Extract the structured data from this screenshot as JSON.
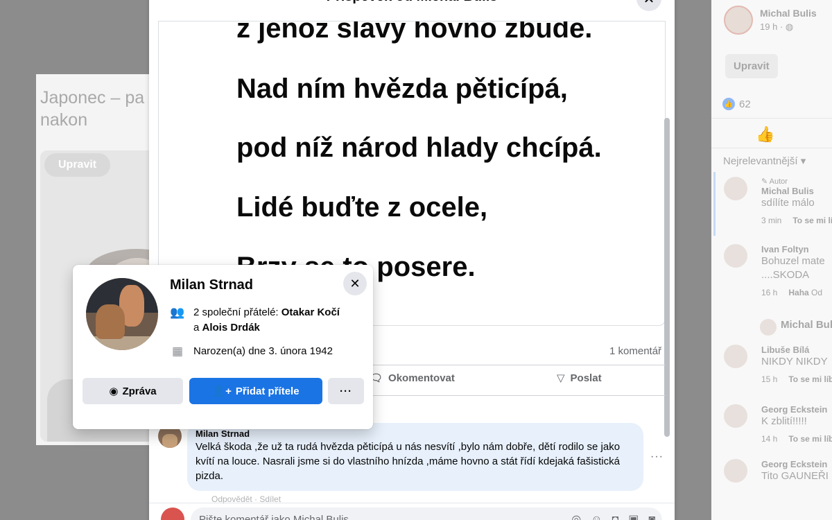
{
  "background_left": {
    "text": "Japonec – pa zemi a nakon",
    "edit_button": "Upravit"
  },
  "right_panel": {
    "author": "Michal Bulis",
    "time": "19 h ·",
    "edit_button": "Upravit",
    "like_count": "62",
    "sort_label": "Nejrelevantnější ▾",
    "comments": [
      {
        "badge": "Autor",
        "name": "Michal Bulis",
        "text": "sdílíte málo",
        "time": "3 min",
        "action": "To se mi líbí"
      },
      {
        "name": "Ivan Foltyn",
        "text": "Bohuzel mate ....SKODA",
        "time": "16 h",
        "action": "Haha",
        "extra": "Od"
      },
      {
        "name": "Michal Bulis"
      },
      {
        "name": "Libuše Bílá",
        "text": "NIKDY NIKDY",
        "time": "15 h",
        "action": "To se mi líbí"
      },
      {
        "name": "Georg Eckstein",
        "text": "K zblití!!!!!",
        "time": "14 h",
        "action": "To se mi líbí"
      },
      {
        "name": "Georg Eckstein",
        "text": "Tito GAUNEŘI"
      }
    ]
  },
  "modal": {
    "title": "Příspěvek od Michal Bulis",
    "poem": [
      "z jenož slávy hovno zbude.",
      "Nad ním hvězda pěticípá,",
      "pod níž národ hlady chcípá.",
      "Lidé buďte z ocele,",
      "Brzy se to posere."
    ],
    "comment_count": "1 komentář",
    "actions": {
      "comment": "Okomentovat",
      "share": "Poslat"
    },
    "comment": {
      "name": "Milan Strnad",
      "text": "Velká škoda ,že už ta rudá hvězda pěticípá u nás nesvítí ,bylo nám dobře, dětí rodilo se jako kvítí na louce. Nasrali jsme si do vlastního hnízda ,máme hovno a stát řídí kdejaká fašistická pizda.",
      "meta": "Odpovědět · Sdílet"
    },
    "write_placeholder": "Pište komentář jako Michal Bulis"
  },
  "hovercard": {
    "name": "Milan Strnad",
    "mutual_prefix": "2 společní přátelé: ",
    "mutual_1": "Otakar Kočí",
    "mutual_and": "a ",
    "mutual_2": "Alois Drdák",
    "born": "Narozen(a) dne 3. února 1942",
    "message_button": "Zpráva",
    "add_friend_button": "Přidat přítele",
    "more_button": "···"
  },
  "colors": {
    "primary": "#1b74e4",
    "secondary_button": "#e4e6eb",
    "comment_bubble": "#e7f0fb"
  }
}
